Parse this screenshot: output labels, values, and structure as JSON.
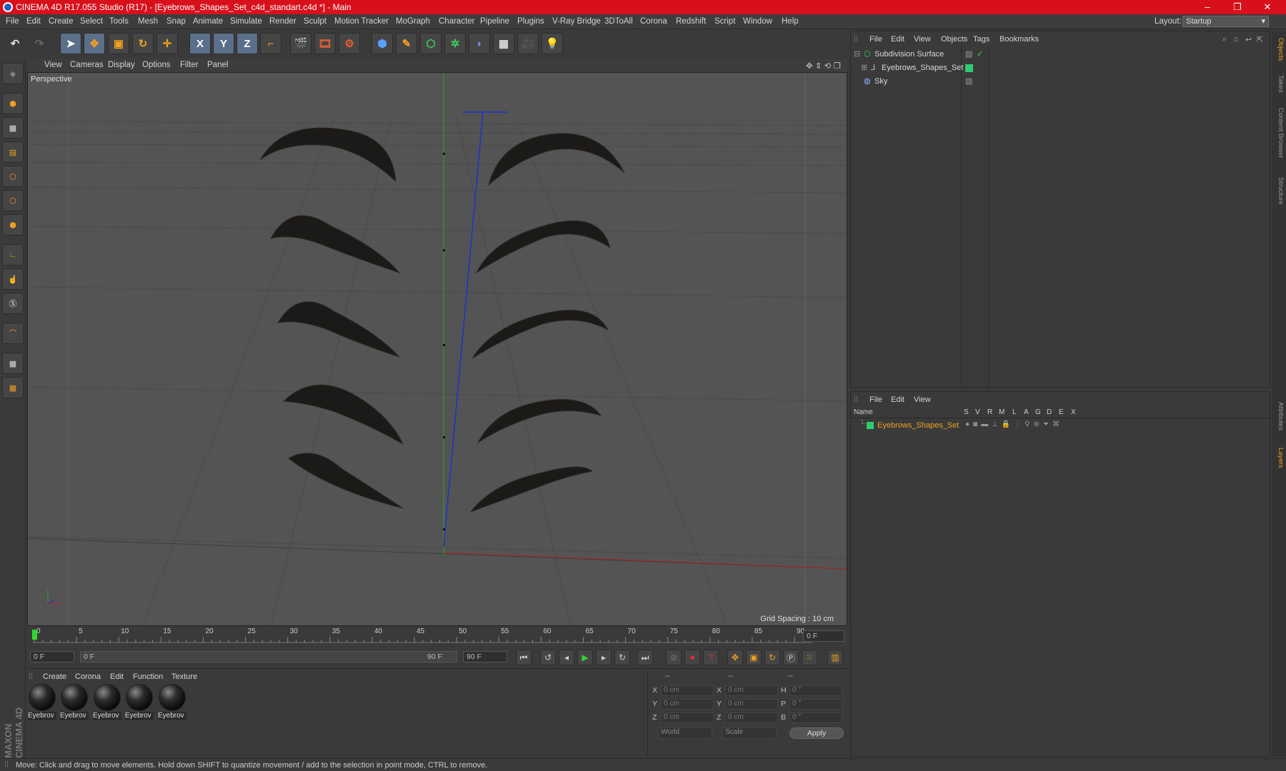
{
  "window": {
    "title": "CINEMA 4D R17.055 Studio (R17) - [Eyebrows_Shapes_Set_c4d_standart.c4d *] - Main",
    "controls": [
      "–",
      "❐",
      "✕"
    ]
  },
  "menu": [
    "File",
    "Edit",
    "Create",
    "Select",
    "Tools",
    "Mesh",
    "Snap",
    "Animate",
    "Simulate",
    "Render",
    "Sculpt",
    "Motion Tracker",
    "MoGraph",
    "Character",
    "Pipeline",
    "Plugins",
    "V-Ray Bridge",
    "3DToAll",
    "Corona",
    "Redshift",
    "Script",
    "Window",
    "Help"
  ],
  "layout": {
    "label": "Layout:",
    "value": "Startup"
  },
  "toolbar": {
    "axis_x": "X",
    "axis_y": "Y",
    "axis_z": "Z"
  },
  "viewport": {
    "menu": [
      "View",
      "Cameras",
      "Display",
      "Options",
      "Filter",
      "Panel"
    ],
    "label": "Perspective",
    "grid_spacing": "Grid Spacing : 10 cm"
  },
  "timeline": {
    "ticks": [
      "0",
      "5",
      "10",
      "15",
      "20",
      "25",
      "30",
      "35",
      "40",
      "45",
      "50",
      "55",
      "60",
      "65",
      "70",
      "75",
      "80",
      "85",
      "90"
    ],
    "current_frame": "0 F"
  },
  "playbar": {
    "start": "0 F",
    "slider_start": "0 F",
    "slider_end": "90 F",
    "end": "90 F"
  },
  "material_manager": {
    "menu": [
      "Create",
      "Corona",
      "Edit",
      "Function",
      "Texture"
    ],
    "materials": [
      "Eyebrov",
      "Eyebrov",
      "Eyebrov",
      "Eyebrov",
      "Eyebrov"
    ]
  },
  "coordinates": {
    "headers": [
      "--",
      "--",
      "--"
    ],
    "rows": [
      {
        "a": "X",
        "av": "0 cm",
        "b": "X",
        "bv": "0 cm",
        "c": "H",
        "cv": "0 °"
      },
      {
        "a": "Y",
        "av": "0 cm",
        "b": "Y",
        "bv": "0 cm",
        "c": "P",
        "cv": "0 °"
      },
      {
        "a": "Z",
        "av": "0 cm",
        "b": "Z",
        "bv": "0 cm",
        "c": "B",
        "cv": "0 °"
      }
    ],
    "world": "World",
    "scale": "Scale",
    "apply": "Apply"
  },
  "object_manager": {
    "menu": [
      "File",
      "Edit",
      "View",
      "Objects",
      "Tags",
      "Bookmarks"
    ],
    "objects": [
      "Subdivision Surface",
      "Eyebrows_Shapes_Set",
      "Sky"
    ]
  },
  "layer_manager": {
    "menu": [
      "File",
      "Edit",
      "View"
    ],
    "columns": [
      "Name",
      "S",
      "V",
      "R",
      "M",
      "L",
      "A",
      "G",
      "D",
      "E",
      "X"
    ],
    "layers": [
      "Eyebrows_Shapes_Set"
    ],
    "layer_color": "#2ecc71"
  },
  "side_tabs": [
    "Objects",
    "Takes",
    "Content Browser",
    "Structure",
    "Attributes",
    "Layers"
  ],
  "branding": "MAXON CINEMA 4D",
  "status": "Move: Click and drag to move elements. Hold down SHIFT to quantize movement / add to the selection in point mode, CTRL to remove."
}
